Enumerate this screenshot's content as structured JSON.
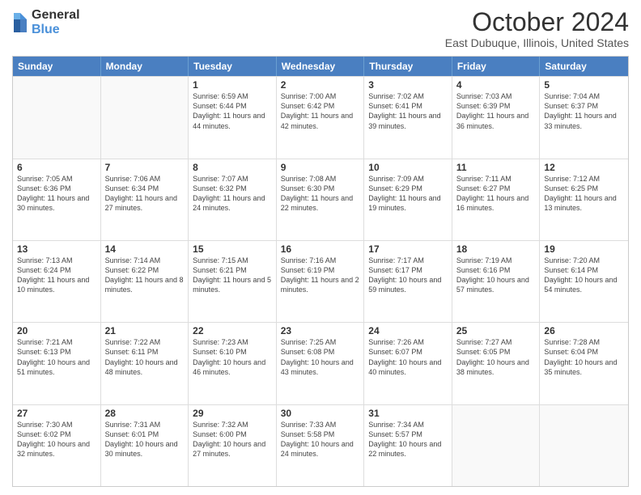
{
  "logo": {
    "general": "General",
    "blue": "Blue"
  },
  "header": {
    "title": "October 2024",
    "subtitle": "East Dubuque, Illinois, United States"
  },
  "days": [
    "Sunday",
    "Monday",
    "Tuesday",
    "Wednesday",
    "Thursday",
    "Friday",
    "Saturday"
  ],
  "weeks": [
    [
      {
        "day": "",
        "empty": true
      },
      {
        "day": "",
        "empty": true
      },
      {
        "day": "1",
        "sunrise": "Sunrise: 6:59 AM",
        "sunset": "Sunset: 6:44 PM",
        "daylight": "Daylight: 11 hours and 44 minutes."
      },
      {
        "day": "2",
        "sunrise": "Sunrise: 7:00 AM",
        "sunset": "Sunset: 6:42 PM",
        "daylight": "Daylight: 11 hours and 42 minutes."
      },
      {
        "day": "3",
        "sunrise": "Sunrise: 7:02 AM",
        "sunset": "Sunset: 6:41 PM",
        "daylight": "Daylight: 11 hours and 39 minutes."
      },
      {
        "day": "4",
        "sunrise": "Sunrise: 7:03 AM",
        "sunset": "Sunset: 6:39 PM",
        "daylight": "Daylight: 11 hours and 36 minutes."
      },
      {
        "day": "5",
        "sunrise": "Sunrise: 7:04 AM",
        "sunset": "Sunset: 6:37 PM",
        "daylight": "Daylight: 11 hours and 33 minutes."
      }
    ],
    [
      {
        "day": "6",
        "sunrise": "Sunrise: 7:05 AM",
        "sunset": "Sunset: 6:36 PM",
        "daylight": "Daylight: 11 hours and 30 minutes."
      },
      {
        "day": "7",
        "sunrise": "Sunrise: 7:06 AM",
        "sunset": "Sunset: 6:34 PM",
        "daylight": "Daylight: 11 hours and 27 minutes."
      },
      {
        "day": "8",
        "sunrise": "Sunrise: 7:07 AM",
        "sunset": "Sunset: 6:32 PM",
        "daylight": "Daylight: 11 hours and 24 minutes."
      },
      {
        "day": "9",
        "sunrise": "Sunrise: 7:08 AM",
        "sunset": "Sunset: 6:30 PM",
        "daylight": "Daylight: 11 hours and 22 minutes."
      },
      {
        "day": "10",
        "sunrise": "Sunrise: 7:09 AM",
        "sunset": "Sunset: 6:29 PM",
        "daylight": "Daylight: 11 hours and 19 minutes."
      },
      {
        "day": "11",
        "sunrise": "Sunrise: 7:11 AM",
        "sunset": "Sunset: 6:27 PM",
        "daylight": "Daylight: 11 hours and 16 minutes."
      },
      {
        "day": "12",
        "sunrise": "Sunrise: 7:12 AM",
        "sunset": "Sunset: 6:25 PM",
        "daylight": "Daylight: 11 hours and 13 minutes."
      }
    ],
    [
      {
        "day": "13",
        "sunrise": "Sunrise: 7:13 AM",
        "sunset": "Sunset: 6:24 PM",
        "daylight": "Daylight: 11 hours and 10 minutes."
      },
      {
        "day": "14",
        "sunrise": "Sunrise: 7:14 AM",
        "sunset": "Sunset: 6:22 PM",
        "daylight": "Daylight: 11 hours and 8 minutes."
      },
      {
        "day": "15",
        "sunrise": "Sunrise: 7:15 AM",
        "sunset": "Sunset: 6:21 PM",
        "daylight": "Daylight: 11 hours and 5 minutes."
      },
      {
        "day": "16",
        "sunrise": "Sunrise: 7:16 AM",
        "sunset": "Sunset: 6:19 PM",
        "daylight": "Daylight: 11 hours and 2 minutes."
      },
      {
        "day": "17",
        "sunrise": "Sunrise: 7:17 AM",
        "sunset": "Sunset: 6:17 PM",
        "daylight": "Daylight: 10 hours and 59 minutes."
      },
      {
        "day": "18",
        "sunrise": "Sunrise: 7:19 AM",
        "sunset": "Sunset: 6:16 PM",
        "daylight": "Daylight: 10 hours and 57 minutes."
      },
      {
        "day": "19",
        "sunrise": "Sunrise: 7:20 AM",
        "sunset": "Sunset: 6:14 PM",
        "daylight": "Daylight: 10 hours and 54 minutes."
      }
    ],
    [
      {
        "day": "20",
        "sunrise": "Sunrise: 7:21 AM",
        "sunset": "Sunset: 6:13 PM",
        "daylight": "Daylight: 10 hours and 51 minutes."
      },
      {
        "day": "21",
        "sunrise": "Sunrise: 7:22 AM",
        "sunset": "Sunset: 6:11 PM",
        "daylight": "Daylight: 10 hours and 48 minutes."
      },
      {
        "day": "22",
        "sunrise": "Sunrise: 7:23 AM",
        "sunset": "Sunset: 6:10 PM",
        "daylight": "Daylight: 10 hours and 46 minutes."
      },
      {
        "day": "23",
        "sunrise": "Sunrise: 7:25 AM",
        "sunset": "Sunset: 6:08 PM",
        "daylight": "Daylight: 10 hours and 43 minutes."
      },
      {
        "day": "24",
        "sunrise": "Sunrise: 7:26 AM",
        "sunset": "Sunset: 6:07 PM",
        "daylight": "Daylight: 10 hours and 40 minutes."
      },
      {
        "day": "25",
        "sunrise": "Sunrise: 7:27 AM",
        "sunset": "Sunset: 6:05 PM",
        "daylight": "Daylight: 10 hours and 38 minutes."
      },
      {
        "day": "26",
        "sunrise": "Sunrise: 7:28 AM",
        "sunset": "Sunset: 6:04 PM",
        "daylight": "Daylight: 10 hours and 35 minutes."
      }
    ],
    [
      {
        "day": "27",
        "sunrise": "Sunrise: 7:30 AM",
        "sunset": "Sunset: 6:02 PM",
        "daylight": "Daylight: 10 hours and 32 minutes."
      },
      {
        "day": "28",
        "sunrise": "Sunrise: 7:31 AM",
        "sunset": "Sunset: 6:01 PM",
        "daylight": "Daylight: 10 hours and 30 minutes."
      },
      {
        "day": "29",
        "sunrise": "Sunrise: 7:32 AM",
        "sunset": "Sunset: 6:00 PM",
        "daylight": "Daylight: 10 hours and 27 minutes."
      },
      {
        "day": "30",
        "sunrise": "Sunrise: 7:33 AM",
        "sunset": "Sunset: 5:58 PM",
        "daylight": "Daylight: 10 hours and 24 minutes."
      },
      {
        "day": "31",
        "sunrise": "Sunrise: 7:34 AM",
        "sunset": "Sunset: 5:57 PM",
        "daylight": "Daylight: 10 hours and 22 minutes."
      },
      {
        "day": "",
        "empty": true
      },
      {
        "day": "",
        "empty": true
      }
    ]
  ]
}
